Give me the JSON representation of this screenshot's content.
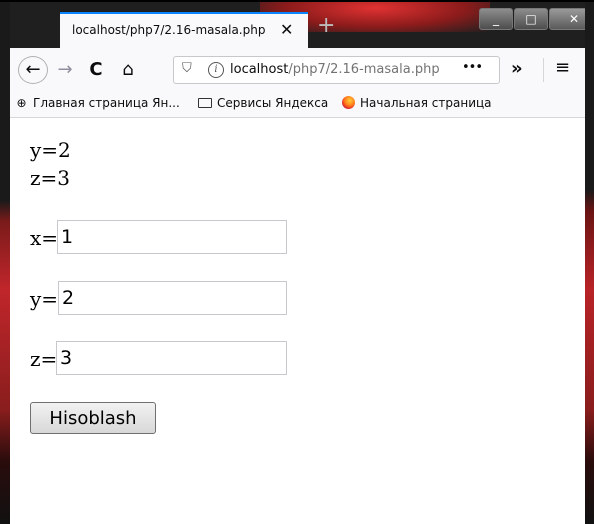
{
  "tab": {
    "title": "localhost/php7/2.16-masala.php",
    "close": "✕",
    "new_tab": "+"
  },
  "window_controls": {
    "minimize": "_",
    "maximize": "□",
    "close": "✕"
  },
  "nav": {
    "back": "←",
    "forward": "→",
    "reload": "C",
    "home": "⌂",
    "url_host": "localhost",
    "url_path": "/php7/2.16-masala.php",
    "url_more": "•••",
    "overflow": "»",
    "menu": "≡"
  },
  "bookmarks": [
    {
      "icon": "globe-icon",
      "glyph": "⊕",
      "label": "Главная страница Ян..."
    },
    {
      "icon": "folder-icon",
      "label": "Сервисы Яндекса"
    },
    {
      "icon": "firefox-icon",
      "label": "Начальная страница"
    }
  ],
  "page": {
    "output": [
      "y=2",
      "z=3"
    ],
    "fields": [
      {
        "label": "x=",
        "value": "1"
      },
      {
        "label": "y=",
        "value": "2"
      },
      {
        "label": "z=",
        "value": "3"
      }
    ],
    "button": "Hisoblash"
  }
}
